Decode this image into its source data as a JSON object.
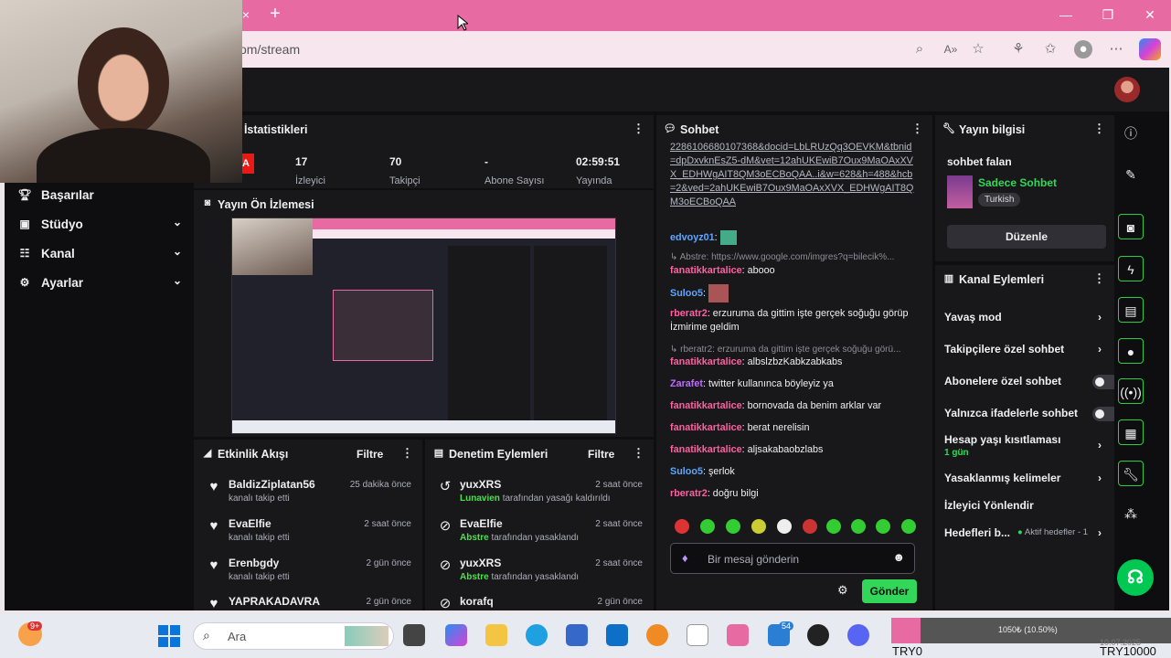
{
  "browser": {
    "url": "om/stream",
    "tab_close": "×",
    "tab_new": "+",
    "minimize": "—",
    "restore": "❐",
    "close": "✕"
  },
  "nav": {
    "items": [
      {
        "label": "Başarılar",
        "icon": "trophy-icon",
        "chevron": ""
      },
      {
        "label": "Stüdyo",
        "icon": "studio-icon",
        "chevron": "⌄"
      },
      {
        "label": "Kanal",
        "icon": "channel-icon",
        "chevron": "⌄"
      },
      {
        "label": "Ayarlar",
        "icon": "gear-icon",
        "chevron": "⌄"
      }
    ]
  },
  "stats": {
    "title": "ı İstatistikleri",
    "values": [
      {
        "value": "17",
        "label": "İzleyici"
      },
      {
        "value": "70",
        "label": "Takipçi"
      },
      {
        "value": "-",
        "label": "Abone Sayısı"
      },
      {
        "value": "02:59:51",
        "label": "Yayında"
      }
    ]
  },
  "preview": {
    "title": "Yayın Ön İzlemesi"
  },
  "activity": {
    "title": "Etkinlik Akışı",
    "filter": "Filtre",
    "rows": [
      {
        "name": "BaldizZiplatan56",
        "desc": "kanalı takip etti",
        "time": "25 dakika önce"
      },
      {
        "name": "EvaElfie",
        "desc": "kanalı takip etti",
        "time": "2 saat önce"
      },
      {
        "name": "Erenbgdy",
        "desc": "kanalı takip etti",
        "time": "2 gün önce"
      },
      {
        "name": "YAPRAKADAVRA",
        "desc": "",
        "time": "2 gün önce"
      }
    ]
  },
  "moderation": {
    "title": "Denetim Eylemleri",
    "filter": "Filtre",
    "rows": [
      {
        "name": "yuxXRS",
        "who": "Lunavien",
        "desc": "tarafından yasağı kaldırıldı",
        "time": "2 saat önce"
      },
      {
        "name": "EvaElfie",
        "who": "Abstre",
        "desc": "tarafından yasaklandı",
        "time": "2 saat önce"
      },
      {
        "name": "yuxXRS",
        "who": "Abstre",
        "desc": "tarafından yasaklandı",
        "time": "2 saat önce"
      },
      {
        "name": "korafq",
        "who": "",
        "desc": "",
        "time": "2 gün önce"
      }
    ]
  },
  "chat": {
    "title": "Sohbet",
    "link_text": "2286106680107368&docid=LbLRUzQq3OEVKM&tbnid=dpDxvknEsZ5-dM&vet=12ahUKEwiB7Oux9MaOAxXVX_EDHWgAIT8QM3oECBoQAA..i&w=628&h=488&hcb=2&ved=2ahUKEwiB7Oux9MaOAxXVX_EDHWgAIT8QM3oECBoQAA",
    "messages": [
      {
        "user": "edvoyz01",
        "sep": ":",
        "text": ""
      },
      {
        "reply": "↳ Abstre: https://www.google.com/imgres?q=bilecik%..."
      },
      {
        "user": "fanatikkartalice",
        "sep": ":",
        "text": " abooo"
      },
      {
        "user": "Suloo5",
        "sep": ":",
        "text": ""
      },
      {
        "user": "rberatr2",
        "sep": ":",
        "text": " erzuruma da gittim işte gerçek soğuğu görüp İzmirime geldim"
      },
      {
        "reply": "↳ rberatr2: erzuruma da gittim işte gerçek soğuğu görü..."
      },
      {
        "user": "fanatikkartalice",
        "sep": ":",
        "text": " albslzbzKabkzabkabs"
      },
      {
        "user": "Zarafet",
        "sep": ":",
        "text": " twitter kullanınca böyleyiz ya"
      },
      {
        "user": "fanatikkartalice",
        "sep": ":",
        "text": " bornovada da benim arklar var"
      },
      {
        "user": "fanatikkartalice",
        "sep": ":",
        "text": " berat nerelisin"
      },
      {
        "user": "fanatikkartalice",
        "sep": ":",
        "text": " aljsakabaobzlabs"
      },
      {
        "user": "Suloo5",
        "sep": ":",
        "text": " şerlok"
      },
      {
        "user": "rberatr2",
        "sep": ":",
        "text": " doğru bilgi"
      }
    ],
    "placeholder": "Bir mesaj gönderin",
    "send": "Gönder"
  },
  "info": {
    "title": "Yayın bilgisi",
    "stream_title": "sohbet falan",
    "category": "Sadece Sohbet",
    "tag": "Turkish",
    "edit": "Düzenle"
  },
  "actions": {
    "title": "Kanal Eylemleri",
    "rows": [
      {
        "label": "Yavaş mod",
        "type": "chevron"
      },
      {
        "label": "Takipçilere özel sohbet",
        "type": "chevron"
      },
      {
        "label": "Abonelere özel sohbet",
        "type": "toggle"
      },
      {
        "label": "Yalnızca ifadelerle sohbet",
        "type": "toggle"
      },
      {
        "label": "Hesap yaşı kısıtlaması",
        "sub": "1 gün",
        "type": "chevron"
      },
      {
        "label": "Yasaklanmış kelimeler",
        "type": "chevron"
      },
      {
        "label": "İzleyici Yönlendir",
        "type": "none"
      },
      {
        "label": "Hedefleri b...",
        "sub": "Aktif hedefler - 1",
        "type": "chevron"
      }
    ]
  },
  "taskbar": {
    "search": "Ara",
    "badge_weather": "9+",
    "badge_mail": "54",
    "stock_left": "TRY0",
    "stock_right": "TRY10000",
    "stock_mid": "1050₺ (10.50%)",
    "date_partial": "10.07.2025"
  },
  "colors": {
    "accent": "#32d75a",
    "titlebar": "#e86aa3",
    "panel": "#18181b",
    "bg": "#0e0e10"
  }
}
